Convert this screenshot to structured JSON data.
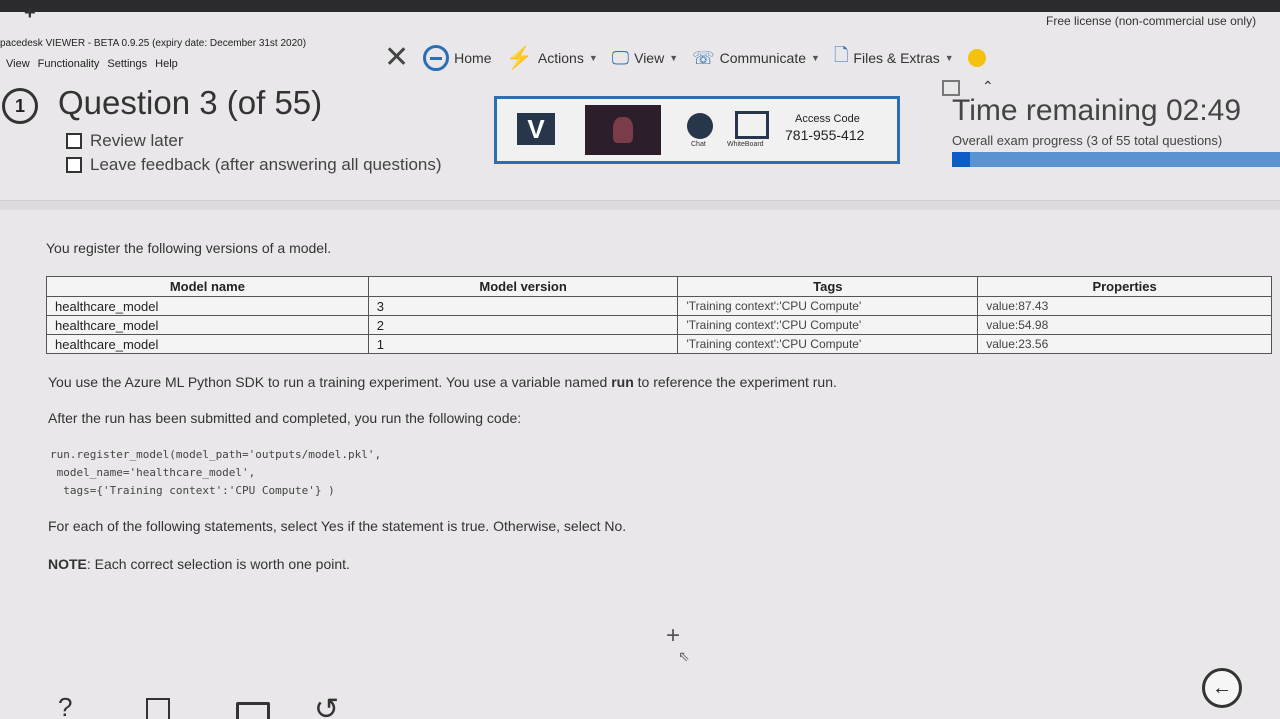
{
  "header": {
    "license_text": "Free license (non-commercial use only)",
    "app_title": "pacedesk VIEWER - BETA 0.9.25 (expiry date: December 31st 2020)",
    "menu": [
      "View",
      "Functionality",
      "Settings",
      "Help"
    ]
  },
  "toolbar": {
    "home": "Home",
    "actions": "Actions",
    "view": "View",
    "communicate": "Communicate",
    "files": "Files & Extras"
  },
  "question": {
    "number_icon": "1",
    "title": "Question 3 (of 55)",
    "review_later": "Review later",
    "leave_feedback": "Leave feedback (after answering all questions)"
  },
  "media_panel": {
    "logo": "V",
    "chat_label": "Chat",
    "whiteboard_label": "WhiteBoard",
    "access_code_label": "Access Code",
    "access_code": "781-955-412"
  },
  "timer": {
    "label": "Time remaining  02:49",
    "progress_label": "Overall exam progress (3 of 55 total questions)",
    "progress_fraction": 0.055
  },
  "body": {
    "intro": "You register the following versions of a model.",
    "table": {
      "headers": [
        "Model name",
        "Model version",
        "Tags",
        "Properties"
      ],
      "rows": [
        [
          "healthcare_model",
          "3",
          "'Training context':'CPU Compute'",
          "value:87.43"
        ],
        [
          "healthcare_model",
          "2",
          "'Training context':'CPU Compute'",
          "value:54.98"
        ],
        [
          "healthcare_model",
          "1",
          "'Training context':'CPU Compute'",
          "value:23.56"
        ]
      ]
    },
    "para1_a": "You use the Azure ML Python SDK to run a training experiment. You use a variable named ",
    "para1_b": "run",
    "para1_c": " to reference the experiment run.",
    "para2": "After the run has been submitted and completed, you run the following code:",
    "code_lines": [
      "run.register_model(model_path='outputs/model.pkl',",
      " model_name='healthcare_model',",
      "  tags={'Training context':'CPU Compute'} )"
    ],
    "para3": "For each of the following statements, select Yes if the statement is true. Otherwise, select No.",
    "note_bold": "NOTE",
    "note_rest": ": Each correct selection is worth one point."
  },
  "bottom": {
    "help_icon": "?"
  }
}
